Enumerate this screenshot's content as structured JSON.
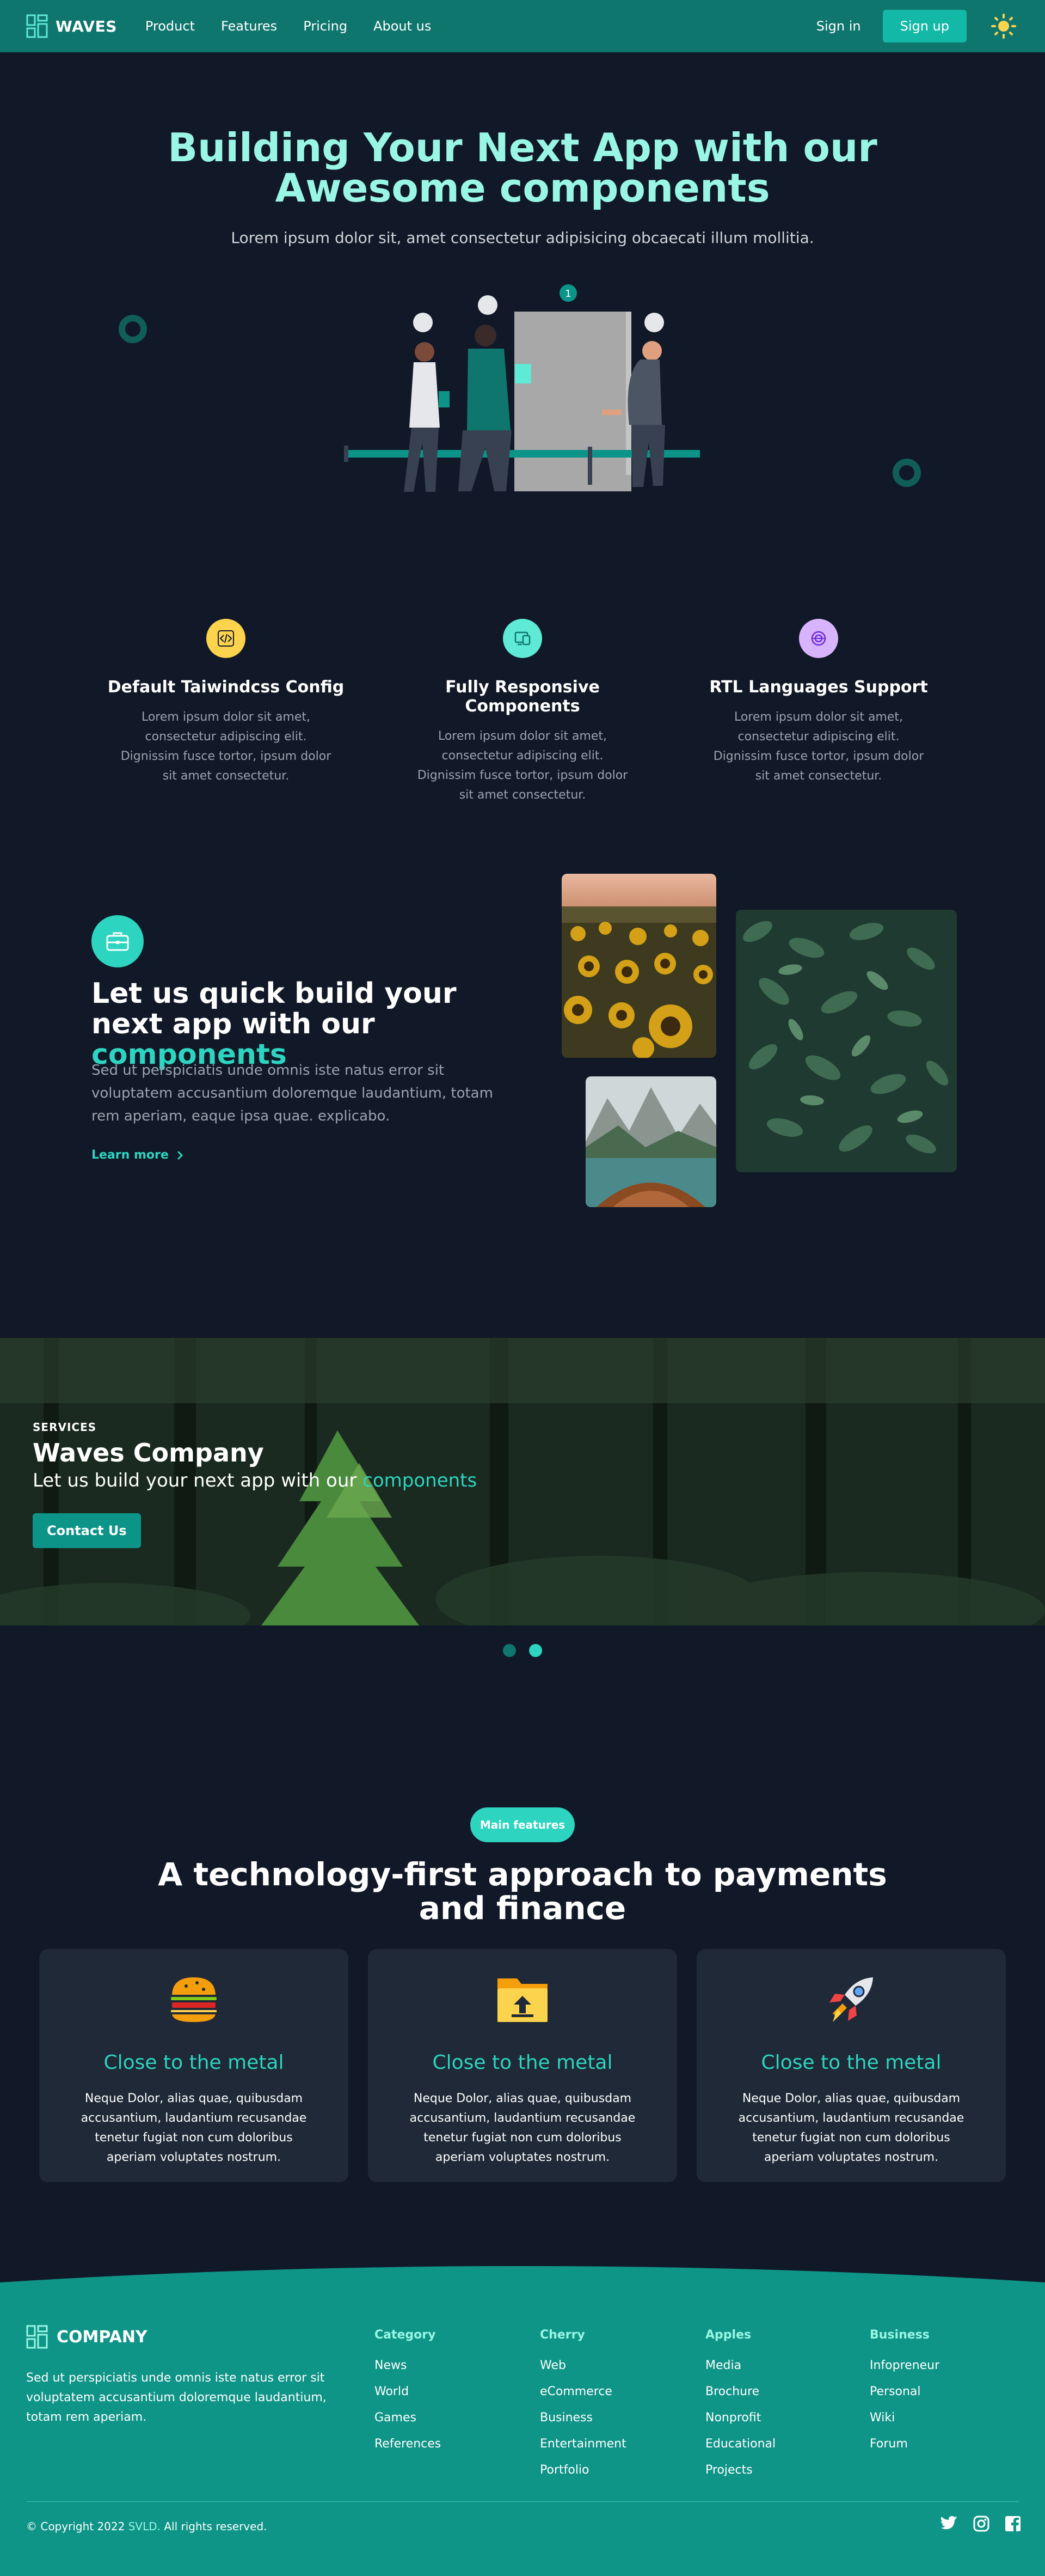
{
  "nav": {
    "brand": "WAVES",
    "links": [
      "Product",
      "Features",
      "Pricing",
      "About us"
    ],
    "signin": "Sign in",
    "signup": "Sign up"
  },
  "hero": {
    "title_line1": "Building Your Next App with our",
    "title_line2": "Awesome components",
    "subtitle": "Lorem ipsum dolor sit, amet consectetur adipisicing obcaecati illum mollitia.",
    "badge_number": "1"
  },
  "features": [
    {
      "title": "Default Taiwindcss Config",
      "desc": "Lorem ipsum dolor sit amet, consectetur adipiscing elit. Dignissim fusce tortor, ipsum dolor sit amet consectetur.",
      "icon": "code-icon",
      "color": "#fcd34d"
    },
    {
      "title": "Fully Responsive Components",
      "desc": "Lorem ipsum dolor sit amet, consectetur adipiscing elit. Dignissim fusce tortor, ipsum dolor sit amet consectetur.",
      "icon": "devices-icon",
      "color": "#5eead4"
    },
    {
      "title": "RTL Languages Support",
      "desc": "Lorem ipsum dolor sit amet, consectetur adipiscing elit. Dignissim fusce tortor, ipsum dolor sit amet consectetur.",
      "icon": "globe-icon",
      "color": "#d8b4fe"
    }
  ],
  "build": {
    "title_part1": "Let us quick build your next app with our",
    "title_accent": "components",
    "desc": "Sed ut perspiciatis unde omnis iste natus error sit voluptatem accusantium doloremque laudantium, totam rem aperiam, eaque ipsa quae. explicabo.",
    "learn_more": "Learn more"
  },
  "banner": {
    "overline": "SERVICES",
    "title": "Waves Company",
    "subtitle_part1": "Let us build your next app with our",
    "subtitle_accent": "components",
    "button": "Contact Us"
  },
  "main_features": {
    "pill": "Main features",
    "title_line1": "A technology-first approach to payments",
    "title_line2": "and finance",
    "cards": [
      {
        "title": "Close to the metal",
        "desc": "Neque Dolor, alias quae, quibusdam accusantium, laudantium recusandae tenetur fugiat non cum doloribus aperiam voluptates nostrum.",
        "icon": "burger-icon"
      },
      {
        "title": "Close to the metal",
        "desc": "Neque Dolor, alias quae, quibusdam accusantium, laudantium recusandae tenetur fugiat non cum doloribus aperiam voluptates nostrum.",
        "icon": "folder-upload-icon"
      },
      {
        "title": "Close to the metal",
        "desc": "Neque Dolor, alias quae, quibusdam accusantium, laudantium recusandae tenetur fugiat non cum doloribus aperiam voluptates nostrum.",
        "icon": "rocket-icon"
      }
    ]
  },
  "footer": {
    "brand": "COMPANY",
    "desc": "Sed ut perspiciatis unde omnis iste natus error sit voluptatem accusantium doloremque laudantium, totam rem aperiam.",
    "columns": [
      {
        "title": "Category",
        "items": [
          "News",
          "World",
          "Games",
          "References"
        ]
      },
      {
        "title": "Cherry",
        "items": [
          "Web",
          "eCommerce",
          "Business",
          "Entertainment",
          "Portfolio"
        ]
      },
      {
        "title": "Apples",
        "items": [
          "Media",
          "Brochure",
          "Nonprofit",
          "Educational",
          "Projects"
        ]
      },
      {
        "title": "Business",
        "items": [
          "Infopreneur",
          "Personal",
          "Wiki",
          "Forum"
        ]
      }
    ],
    "copyright_prefix": "© Copyright 2022",
    "copyright_brand": "SVLD.",
    "copyright_suffix": "All rights reserved."
  },
  "colors": {
    "accent": "#2dd4bf",
    "primary": "#0f766e",
    "background": "#111827",
    "card": "#1f2937"
  }
}
